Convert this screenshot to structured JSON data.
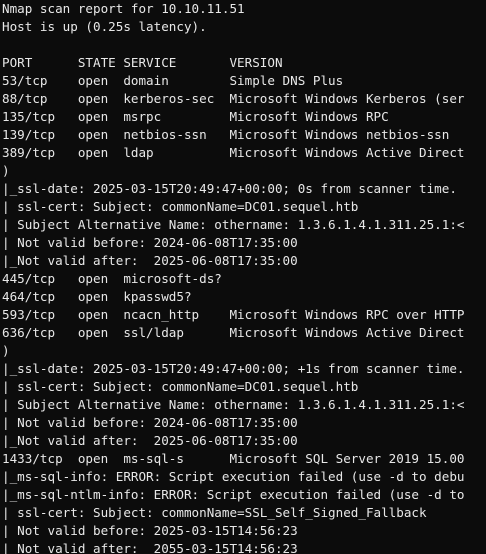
{
  "terminal": {
    "lines": [
      "Nmap scan report for 10.10.11.51",
      "Host is up (0.25s latency).",
      "",
      "PORT      STATE SERVICE       VERSION",
      "53/tcp    open  domain        Simple DNS Plus",
      "88/tcp    open  kerberos-sec  Microsoft Windows Kerberos (ser",
      "135/tcp   open  msrpc         Microsoft Windows RPC",
      "139/tcp   open  netbios-ssn   Microsoft Windows netbios-ssn",
      "389/tcp   open  ldap          Microsoft Windows Active Direct",
      ")",
      "|_ssl-date: 2025-03-15T20:49:47+00:00; 0s from scanner time.",
      "| ssl-cert: Subject: commonName=DC01.sequel.htb",
      "| Subject Alternative Name: othername: 1.3.6.1.4.1.311.25.1:<",
      "| Not valid before: 2024-06-08T17:35:00",
      "|_Not valid after:  2025-06-08T17:35:00",
      "445/tcp   open  microsoft-ds?",
      "464/tcp   open  kpasswd5?",
      "593/tcp   open  ncacn_http    Microsoft Windows RPC over HTTP",
      "636/tcp   open  ssl/ldap      Microsoft Windows Active Direct",
      ")",
      "|_ssl-date: 2025-03-15T20:49:47+00:00; +1s from scanner time.",
      "| ssl-cert: Subject: commonName=DC01.sequel.htb",
      "| Subject Alternative Name: othername: 1.3.6.1.4.1.311.25.1:<",
      "| Not valid before: 2024-06-08T17:35:00",
      "|_Not valid after:  2025-06-08T17:35:00",
      "1433/tcp  open  ms-sql-s      Microsoft SQL Server 2019 15.00",
      "|_ms-sql-info: ERROR: Script execution failed (use -d to debu",
      "|_ms-sql-ntlm-info: ERROR: Script execution failed (use -d to",
      "| ssl-cert: Subject: commonName=SSL_Self_Signed_Fallback",
      "| Not valid before: 2025-03-15T14:56:23",
      "|_Not valid after:  2055-03-15T14:56:23"
    ]
  }
}
